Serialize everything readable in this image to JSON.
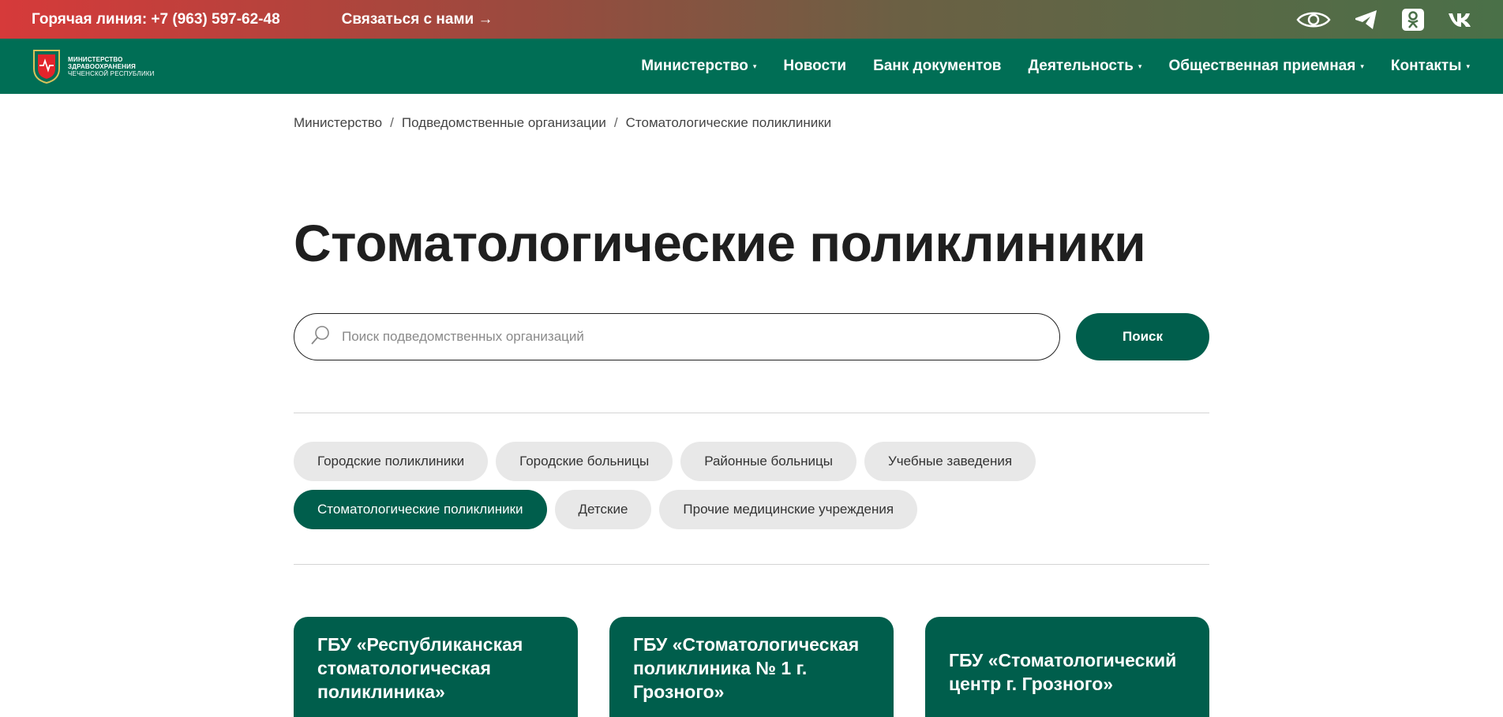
{
  "topbar": {
    "hotline": "Горячая линия: +7 (963) 597-62-48",
    "contact": "Связаться с нами →",
    "icons": [
      "eye-icon",
      "telegram-icon",
      "odnoklassniki-icon",
      "vk-icon"
    ]
  },
  "logo": {
    "line1": "МИНИСТЕРСТВО",
    "line2": "ЗДРАВООХРАНЕНИЯ",
    "line3": "ЧЕЧЕНСКОЙ РЕСПУБЛИКИ"
  },
  "nav": {
    "items": [
      {
        "label": "Министерство",
        "dropdown": true
      },
      {
        "label": "Новости",
        "dropdown": false
      },
      {
        "label": "Банк документов",
        "dropdown": false
      },
      {
        "label": "Деятельность",
        "dropdown": true
      },
      {
        "label": "Общественная приемная",
        "dropdown": true
      },
      {
        "label": "Контакты",
        "dropdown": true
      }
    ],
    "caret": "▾"
  },
  "breadcrumb": {
    "items": [
      "Министерство",
      "Подведомственные организации",
      "Стоматологические поликлиники"
    ],
    "separator": "/"
  },
  "page": {
    "title": "Стоматологические поликлиники"
  },
  "search": {
    "placeholder": "Поиск подведомственных организаций",
    "value": "",
    "button_label": "Поиск"
  },
  "filters": {
    "row1": [
      "Городские поликлиники",
      "Городские больницы",
      "Районные больницы",
      "Учебные заведения"
    ],
    "row2": [
      "Стоматологические поликлиники",
      "Детские",
      "Прочие медицинские учреждения"
    ],
    "active": "Стоматологические поликлиники"
  },
  "cards": [
    {
      "title": "ГБУ «Республиканская стоматологическая поликлиника»"
    },
    {
      "title": "ГБУ «Стоматологическая поликлиника № 1 г. Грозного»"
    },
    {
      "title": "ГБУ «Стоматологический центр г. Грозного»"
    }
  ],
  "colors": {
    "brand_green": "#006e55",
    "dark_green": "#005e4c",
    "chip_gray": "#e8e8e8",
    "topbar_red": "#d63a3a"
  }
}
